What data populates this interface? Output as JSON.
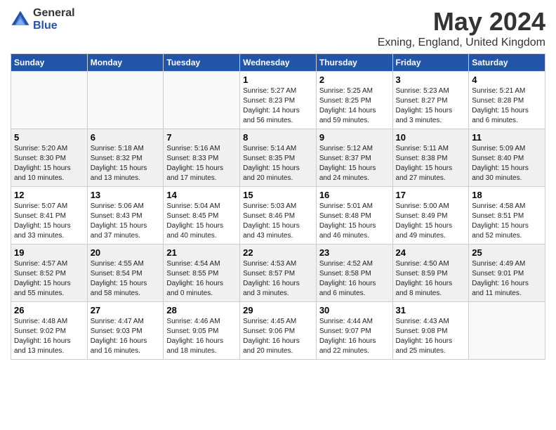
{
  "logo": {
    "general": "General",
    "blue": "Blue"
  },
  "title": {
    "month_year": "May 2024",
    "location": "Exning, England, United Kingdom"
  },
  "days_of_week": [
    "Sunday",
    "Monday",
    "Tuesday",
    "Wednesday",
    "Thursday",
    "Friday",
    "Saturday"
  ],
  "weeks": [
    {
      "shaded": false,
      "days": [
        {
          "number": "",
          "info": ""
        },
        {
          "number": "",
          "info": ""
        },
        {
          "number": "",
          "info": ""
        },
        {
          "number": "1",
          "info": "Sunrise: 5:27 AM\nSunset: 8:23 PM\nDaylight: 14 hours\nand 56 minutes."
        },
        {
          "number": "2",
          "info": "Sunrise: 5:25 AM\nSunset: 8:25 PM\nDaylight: 14 hours\nand 59 minutes."
        },
        {
          "number": "3",
          "info": "Sunrise: 5:23 AM\nSunset: 8:27 PM\nDaylight: 15 hours\nand 3 minutes."
        },
        {
          "number": "4",
          "info": "Sunrise: 5:21 AM\nSunset: 8:28 PM\nDaylight: 15 hours\nand 6 minutes."
        }
      ]
    },
    {
      "shaded": true,
      "days": [
        {
          "number": "5",
          "info": "Sunrise: 5:20 AM\nSunset: 8:30 PM\nDaylight: 15 hours\nand 10 minutes."
        },
        {
          "number": "6",
          "info": "Sunrise: 5:18 AM\nSunset: 8:32 PM\nDaylight: 15 hours\nand 13 minutes."
        },
        {
          "number": "7",
          "info": "Sunrise: 5:16 AM\nSunset: 8:33 PM\nDaylight: 15 hours\nand 17 minutes."
        },
        {
          "number": "8",
          "info": "Sunrise: 5:14 AM\nSunset: 8:35 PM\nDaylight: 15 hours\nand 20 minutes."
        },
        {
          "number": "9",
          "info": "Sunrise: 5:12 AM\nSunset: 8:37 PM\nDaylight: 15 hours\nand 24 minutes."
        },
        {
          "number": "10",
          "info": "Sunrise: 5:11 AM\nSunset: 8:38 PM\nDaylight: 15 hours\nand 27 minutes."
        },
        {
          "number": "11",
          "info": "Sunrise: 5:09 AM\nSunset: 8:40 PM\nDaylight: 15 hours\nand 30 minutes."
        }
      ]
    },
    {
      "shaded": false,
      "days": [
        {
          "number": "12",
          "info": "Sunrise: 5:07 AM\nSunset: 8:41 PM\nDaylight: 15 hours\nand 33 minutes."
        },
        {
          "number": "13",
          "info": "Sunrise: 5:06 AM\nSunset: 8:43 PM\nDaylight: 15 hours\nand 37 minutes."
        },
        {
          "number": "14",
          "info": "Sunrise: 5:04 AM\nSunset: 8:45 PM\nDaylight: 15 hours\nand 40 minutes."
        },
        {
          "number": "15",
          "info": "Sunrise: 5:03 AM\nSunset: 8:46 PM\nDaylight: 15 hours\nand 43 minutes."
        },
        {
          "number": "16",
          "info": "Sunrise: 5:01 AM\nSunset: 8:48 PM\nDaylight: 15 hours\nand 46 minutes."
        },
        {
          "number": "17",
          "info": "Sunrise: 5:00 AM\nSunset: 8:49 PM\nDaylight: 15 hours\nand 49 minutes."
        },
        {
          "number": "18",
          "info": "Sunrise: 4:58 AM\nSunset: 8:51 PM\nDaylight: 15 hours\nand 52 minutes."
        }
      ]
    },
    {
      "shaded": true,
      "days": [
        {
          "number": "19",
          "info": "Sunrise: 4:57 AM\nSunset: 8:52 PM\nDaylight: 15 hours\nand 55 minutes."
        },
        {
          "number": "20",
          "info": "Sunrise: 4:55 AM\nSunset: 8:54 PM\nDaylight: 15 hours\nand 58 minutes."
        },
        {
          "number": "21",
          "info": "Sunrise: 4:54 AM\nSunset: 8:55 PM\nDaylight: 16 hours\nand 0 minutes."
        },
        {
          "number": "22",
          "info": "Sunrise: 4:53 AM\nSunset: 8:57 PM\nDaylight: 16 hours\nand 3 minutes."
        },
        {
          "number": "23",
          "info": "Sunrise: 4:52 AM\nSunset: 8:58 PM\nDaylight: 16 hours\nand 6 minutes."
        },
        {
          "number": "24",
          "info": "Sunrise: 4:50 AM\nSunset: 8:59 PM\nDaylight: 16 hours\nand 8 minutes."
        },
        {
          "number": "25",
          "info": "Sunrise: 4:49 AM\nSunset: 9:01 PM\nDaylight: 16 hours\nand 11 minutes."
        }
      ]
    },
    {
      "shaded": false,
      "days": [
        {
          "number": "26",
          "info": "Sunrise: 4:48 AM\nSunset: 9:02 PM\nDaylight: 16 hours\nand 13 minutes."
        },
        {
          "number": "27",
          "info": "Sunrise: 4:47 AM\nSunset: 9:03 PM\nDaylight: 16 hours\nand 16 minutes."
        },
        {
          "number": "28",
          "info": "Sunrise: 4:46 AM\nSunset: 9:05 PM\nDaylight: 16 hours\nand 18 minutes."
        },
        {
          "number": "29",
          "info": "Sunrise: 4:45 AM\nSunset: 9:06 PM\nDaylight: 16 hours\nand 20 minutes."
        },
        {
          "number": "30",
          "info": "Sunrise: 4:44 AM\nSunset: 9:07 PM\nDaylight: 16 hours\nand 22 minutes."
        },
        {
          "number": "31",
          "info": "Sunrise: 4:43 AM\nSunset: 9:08 PM\nDaylight: 16 hours\nand 25 minutes."
        },
        {
          "number": "",
          "info": ""
        }
      ]
    }
  ]
}
